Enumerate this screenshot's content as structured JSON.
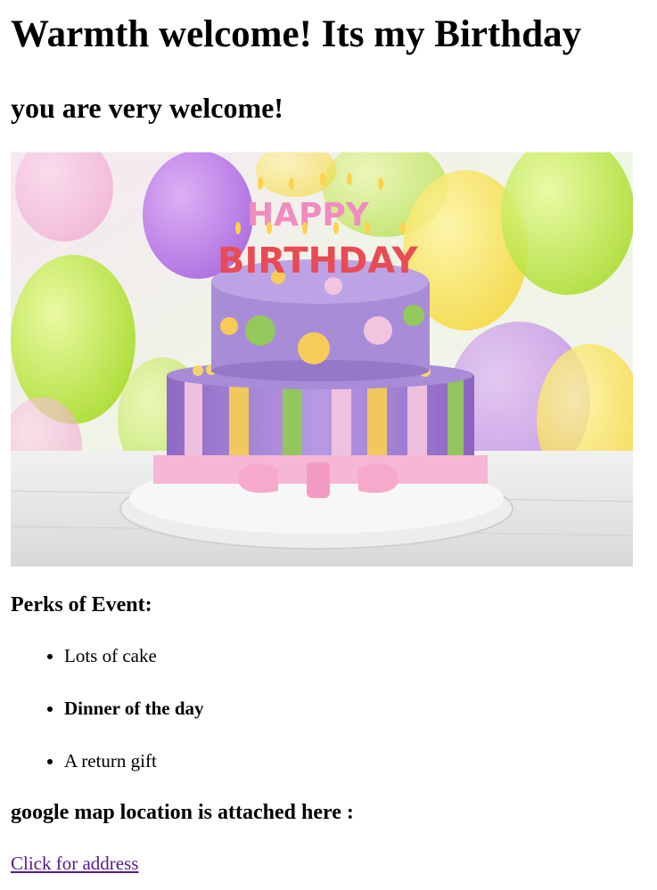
{
  "page": {
    "heading": "Warmth welcome! Its my Birthday",
    "subheading": "you are very welcome!"
  },
  "hero_image": {
    "icon": "birthday-cake-image",
    "candle_text_top": "HAPPY",
    "candle_text_bottom": "BIRTHDAY"
  },
  "perks": {
    "title": "Perks of Event:",
    "items": [
      {
        "label": "Lots of cake"
      },
      {
        "label": "Dinner of the day"
      },
      {
        "label": "A return gift"
      }
    ]
  },
  "map": {
    "title": "google map location is attached here :",
    "link_label": "Click for address"
  },
  "colors": {
    "link": "#551a8b",
    "text": "#000000"
  }
}
